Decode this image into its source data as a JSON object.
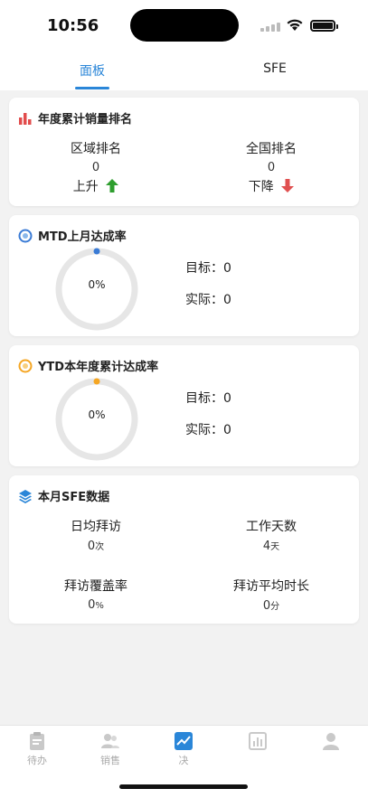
{
  "status": {
    "time": "10:56"
  },
  "tabs": [
    {
      "label": "面板",
      "active": true
    },
    {
      "label": "SFE",
      "active": false
    }
  ],
  "ranking": {
    "title": "年度累计销量排名",
    "regional": {
      "label": "区域排名",
      "value": "0",
      "trend": "上升"
    },
    "national": {
      "label": "全国排名",
      "value": "0",
      "trend": "下降"
    }
  },
  "mtd": {
    "title": "MTD上月达成率",
    "percent": "0%",
    "target": "目标：0",
    "actual": "实际：0",
    "accent": "#3a7bd5"
  },
  "ytd": {
    "title": "YTD本年度累计达成率",
    "percent": "0%",
    "target": "目标：0",
    "actual": "实际：0",
    "accent": "#f5a623"
  },
  "sfe": {
    "title": "本月SFE数据",
    "items": [
      {
        "label": "日均拜访",
        "value": "0",
        "unit": "次"
      },
      {
        "label": "工作天数",
        "value": "4",
        "unit": "天"
      },
      {
        "label": "拜访覆盖率",
        "value": "0",
        "unit": "%"
      },
      {
        "label": "拜访平均时长",
        "value": "0",
        "unit": "分"
      }
    ]
  },
  "bottom_nav": [
    {
      "label": "待办",
      "icon": "clipboard-icon"
    },
    {
      "label": "销售",
      "icon": "people-icon"
    },
    {
      "label": "决",
      "icon": "trend-icon",
      "active": true
    },
    {
      "label": "",
      "icon": "report-icon"
    },
    {
      "label": "",
      "icon": "person-icon"
    }
  ],
  "colors": {
    "brand": "#2a86d8",
    "up": "#2e9e2e",
    "down": "#e05050",
    "bar": "#e24c4c"
  }
}
